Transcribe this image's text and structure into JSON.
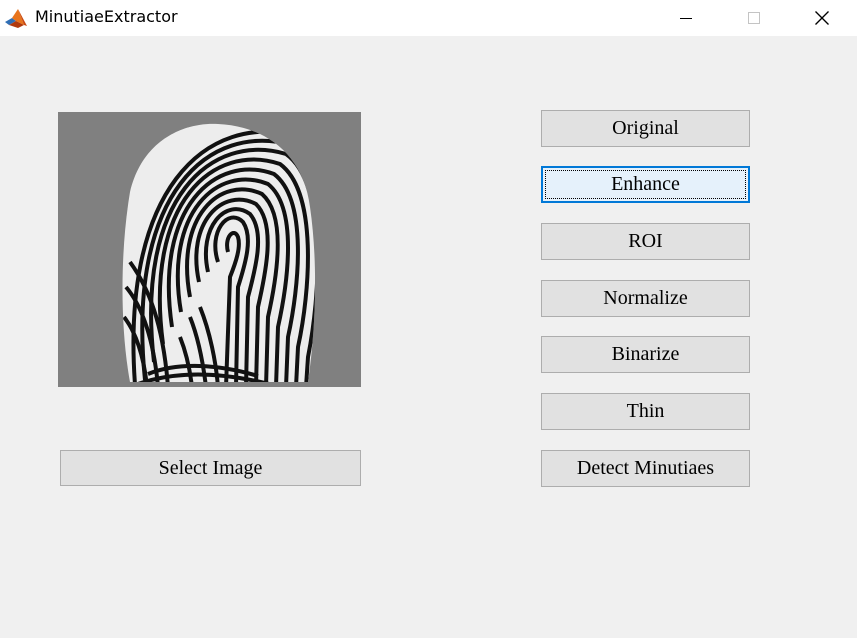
{
  "window": {
    "title": "MinutiaeExtractor",
    "app_icon": "matlab-icon",
    "controls": {
      "minimize_icon": "minimize-icon",
      "maximize_icon": "maximize-icon",
      "close_icon": "close-icon"
    }
  },
  "image_panel": {
    "content": "fingerprint-image"
  },
  "buttons": {
    "select_image": "Select Image",
    "side": [
      {
        "label": "Original",
        "focused": false
      },
      {
        "label": "Enhance",
        "focused": true
      },
      {
        "label": "ROI",
        "focused": false
      },
      {
        "label": "Normalize",
        "focused": false
      },
      {
        "label": "Binarize",
        "focused": false
      },
      {
        "label": "Thin",
        "focused": false
      },
      {
        "label": "Detect Minutiaes",
        "focused": false
      }
    ]
  },
  "colors": {
    "background": "#f0f0f0",
    "titlebar": "#ffffff",
    "button_face": "#e1e1e1",
    "button_border": "#adadad",
    "focus_border": "#0078d7",
    "focus_face": "#e5f1fb",
    "panel_gray": "#808080"
  }
}
